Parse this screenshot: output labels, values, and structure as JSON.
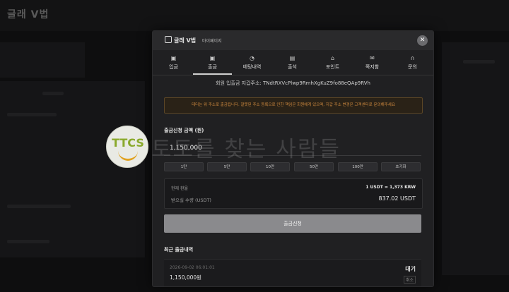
{
  "background": {
    "logo": "글래 V법"
  },
  "modal": {
    "logo": "글래 V법",
    "mypage_label": "마이페이지",
    "close_icon": "close-icon",
    "tabs": [
      {
        "label": "입금",
        "icon": "deposit-icon"
      },
      {
        "label": "출금",
        "icon": "withdraw-icon",
        "active": true
      },
      {
        "label": "베팅내역",
        "icon": "clock-icon"
      },
      {
        "label": "출석",
        "icon": "calendar-icon"
      },
      {
        "label": "포인트",
        "icon": "gift-icon"
      },
      {
        "label": "쪽지함",
        "icon": "mail-icon"
      },
      {
        "label": "문의",
        "icon": "headset-icon"
      }
    ],
    "address_label": "회원 입출금 지갑주소:",
    "address_value": "TNdtRXVcPlwp9RmhXgKuZ9fo88eQAp9RVh",
    "warning": "테더는 위 주소로 출금됩니다. 잘못된 주소 등록으로 인한 책임은 회원에게 있으며, 지갑 주소 변경은 고객센터로 문의해주세요",
    "amount_label": "출금신청 금액 (원)",
    "amount_value": "1,150,000",
    "quick_buttons": [
      "1만",
      "5만",
      "10만",
      "50만",
      "100만",
      "초기화"
    ],
    "rate_label": "현재 환율",
    "rate_value": "1 USDT = 1,373 KRW",
    "receive_label": "받으실 수량 (USDT)",
    "receive_value": "837.02 USDT",
    "submit_label": "출금신청",
    "recent_title": "최근 출금내역",
    "history": [
      {
        "date": "2026-09-02 06:01:01",
        "amount": "1,150,000원",
        "status": "대기",
        "cancel": "취소"
      }
    ]
  },
  "watermark": {
    "badge_text": "TTCS",
    "slogan": "토토를 찾는 사람들"
  }
}
